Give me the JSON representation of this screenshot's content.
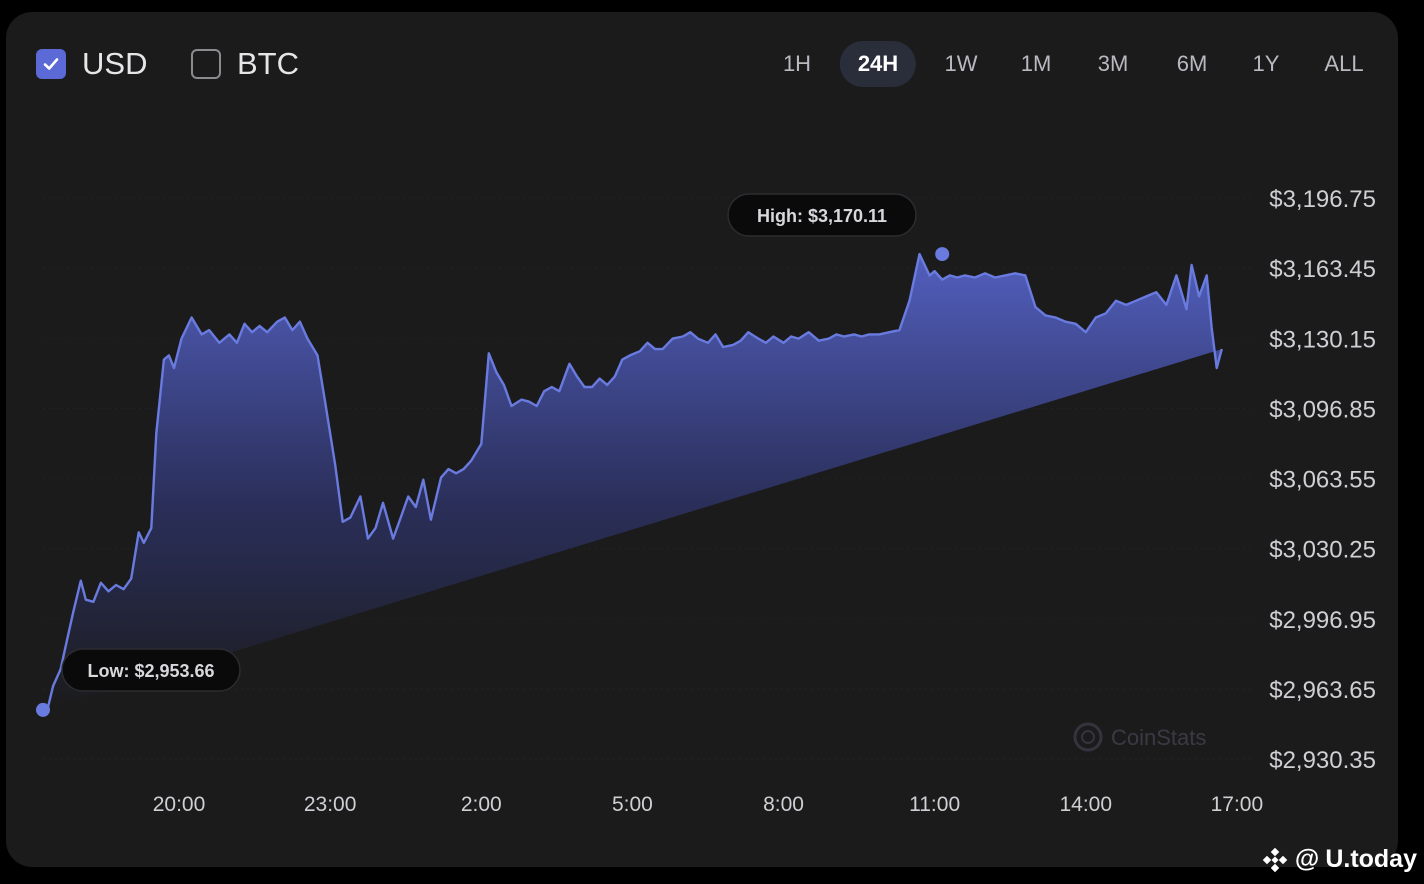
{
  "currency_toggles": [
    {
      "label": "USD",
      "checked": true
    },
    {
      "label": "BTC",
      "checked": false
    }
  ],
  "time_tabs": [
    "1H",
    "24H",
    "1W",
    "1M",
    "3M",
    "6M",
    "1Y",
    "ALL"
  ],
  "active_tab": "24H",
  "watermark": "CoinStats",
  "brand": {
    "at": "@",
    "name": "U.today"
  },
  "colors": {
    "line": "#6a7be0",
    "fill_top": "#5563c7",
    "fill_bottom": "#1b1b1c",
    "accent": "#5b6ad6",
    "background": "#1b1b1c"
  },
  "chart_data": {
    "type": "area",
    "y_tick_labels": [
      "$3,196.75",
      "$3,163.45",
      "$3,130.15",
      "$3,096.85",
      "$3,063.55",
      "$3,030.25",
      "$2,996.95",
      "$2,963.65",
      "$2,930.35"
    ],
    "y_ticks": [
      3196.75,
      3163.45,
      3130.15,
      3096.85,
      3063.55,
      3030.25,
      2996.95,
      2963.65,
      2930.35
    ],
    "x_tick_labels": [
      "20:00",
      "23:00",
      "2:00",
      "5:00",
      "8:00",
      "11:00",
      "14:00",
      "17:00"
    ],
    "x_ticks": [
      20,
      23,
      26,
      29,
      32,
      35,
      38,
      41
    ],
    "xlim": [
      17.3,
      41.3
    ],
    "ylim": [
      2920,
      3210
    ],
    "high": {
      "label": "High: $3,170.11",
      "x": 35.15,
      "y": 3170.11
    },
    "low": {
      "label": "Low: $2,953.66",
      "x": 17.3,
      "y": 2953.66
    },
    "x": [
      17.3,
      17.4,
      17.5,
      17.65,
      17.75,
      17.9,
      18.05,
      18.15,
      18.3,
      18.45,
      18.6,
      18.75,
      18.9,
      19.05,
      19.2,
      19.3,
      19.45,
      19.55,
      19.7,
      19.8,
      19.9,
      20.05,
      20.25,
      20.45,
      20.6,
      20.8,
      21.0,
      21.15,
      21.3,
      21.45,
      21.6,
      21.75,
      21.95,
      22.1,
      22.25,
      22.4,
      22.55,
      22.75,
      22.9,
      23.1,
      23.25,
      23.4,
      23.6,
      23.75,
      23.9,
      24.05,
      24.25,
      24.4,
      24.55,
      24.7,
      24.85,
      25.0,
      25.2,
      25.35,
      25.5,
      25.65,
      25.8,
      26.0,
      26.15,
      26.3,
      26.45,
      26.6,
      26.8,
      26.95,
      27.1,
      27.25,
      27.4,
      27.55,
      27.75,
      27.9,
      28.05,
      28.2,
      28.35,
      28.5,
      28.65,
      28.8,
      28.95,
      29.15,
      29.3,
      29.45,
      29.6,
      29.8,
      30.0,
      30.15,
      30.3,
      30.5,
      30.65,
      30.8,
      31.0,
      31.15,
      31.3,
      31.5,
      31.65,
      31.8,
      32.0,
      32.15,
      32.3,
      32.5,
      32.7,
      32.9,
      33.05,
      33.2,
      33.4,
      33.55,
      33.7,
      33.9,
      34.1,
      34.3,
      34.5,
      34.7,
      34.9,
      35.0,
      35.15,
      35.3,
      35.45,
      35.6,
      35.8,
      36.0,
      36.2,
      36.4,
      36.6,
      36.8,
      37.0,
      37.2,
      37.4,
      37.6,
      37.8,
      38.0,
      38.2,
      38.4,
      38.6,
      38.8,
      39.0,
      39.2,
      39.4,
      39.6,
      39.8,
      40.0,
      40.1,
      40.25,
      40.4,
      40.5,
      40.6,
      40.7,
      40.8,
      40.9,
      41.0,
      41.1,
      41.2,
      41.3
    ],
    "y": [
      2953.66,
      2955.0,
      2965.0,
      2973.0,
      2984.0,
      3000.0,
      3015.0,
      3006.0,
      3005.0,
      3014.0,
      3010.0,
      3013.0,
      3011.0,
      3016.0,
      3038.0,
      3033.0,
      3040.0,
      3085.0,
      3120.0,
      3122.0,
      3116.0,
      3130.0,
      3140.0,
      3132.0,
      3134.0,
      3128.0,
      3132.0,
      3128.0,
      3137.0,
      3133.0,
      3136.0,
      3133.0,
      3138.0,
      3140.0,
      3134.0,
      3138.0,
      3130.0,
      3122.0,
      3100.0,
      3070.0,
      3043.0,
      3045.0,
      3055.0,
      3035.0,
      3040.0,
      3052.0,
      3035.0,
      3045.0,
      3055.0,
      3050.0,
      3063.0,
      3044.0,
      3064.0,
      3068.0,
      3066.0,
      3068.0,
      3072.0,
      3080.0,
      3123.0,
      3114.0,
      3108.0,
      3098.0,
      3101.0,
      3100.0,
      3098.0,
      3105.0,
      3107.0,
      3105.0,
      3118.0,
      3112.0,
      3107.0,
      3107.0,
      3111.0,
      3108.0,
      3112.0,
      3120.0,
      3122.0,
      3124.0,
      3128.0,
      3125.0,
      3125.0,
      3130.0,
      3131.0,
      3133.0,
      3130.0,
      3128.0,
      3132.0,
      3126.0,
      3127.0,
      3129.0,
      3133.0,
      3130.0,
      3128.0,
      3131.0,
      3128.0,
      3131.0,
      3130.0,
      3133.0,
      3129.0,
      3130.0,
      3132.0,
      3131.0,
      3132.0,
      3131.0,
      3132.0,
      3132.0,
      3133.0,
      3134.0,
      3148.0,
      3170.11,
      3160.0,
      3162.0,
      3158.0,
      3160.0,
      3159.0,
      3160.0,
      3159.0,
      3161.0,
      3159.0,
      3160.0,
      3161.0,
      3160.0,
      3145.0,
      3141.0,
      3140.0,
      3138.0,
      3137.0,
      3133.0,
      3140.0,
      3142.0,
      3148.0,
      3146.0,
      3148.0,
      3150.0,
      3152.0,
      3146.0,
      3160.0,
      3144.0,
      3165.0,
      3150.0,
      3160.0,
      3135.0,
      3116.0,
      3125.0
    ]
  }
}
